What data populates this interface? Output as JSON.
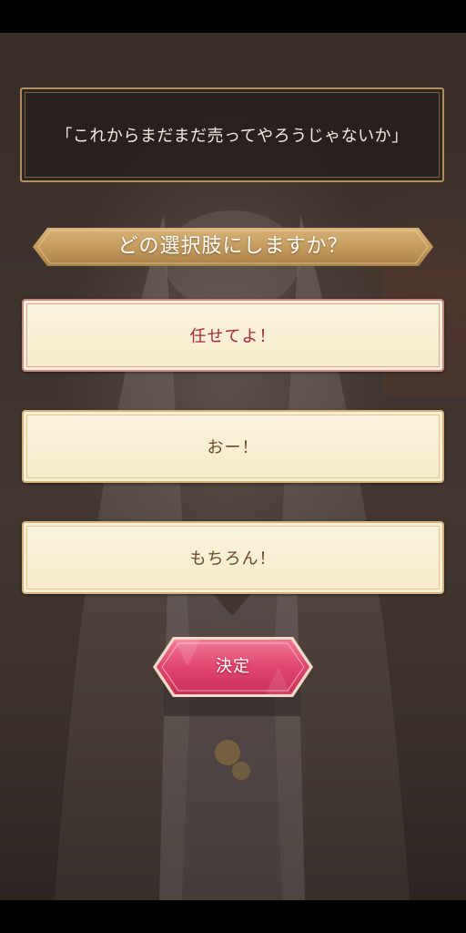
{
  "dialogue": {
    "text": "「これからまだまだ売ってやろうじゃないか」"
  },
  "question": {
    "text": "どの選択肢にしますか？"
  },
  "choices": [
    {
      "label": "任せてよ！",
      "selected": true
    },
    {
      "label": "おー！",
      "selected": false
    },
    {
      "label": "もちろん！",
      "selected": false
    }
  ],
  "decide_button": {
    "label": "決定"
  },
  "colors": {
    "dialogue_bg": "#26201e",
    "frame_gold": "#b08c5a",
    "banner_gold": "#c9a66b",
    "choice_bg": "#f8efd4",
    "selected_text": "#a8283a",
    "choice_text": "#6a4a24",
    "decide_pink": "#e0456e"
  }
}
